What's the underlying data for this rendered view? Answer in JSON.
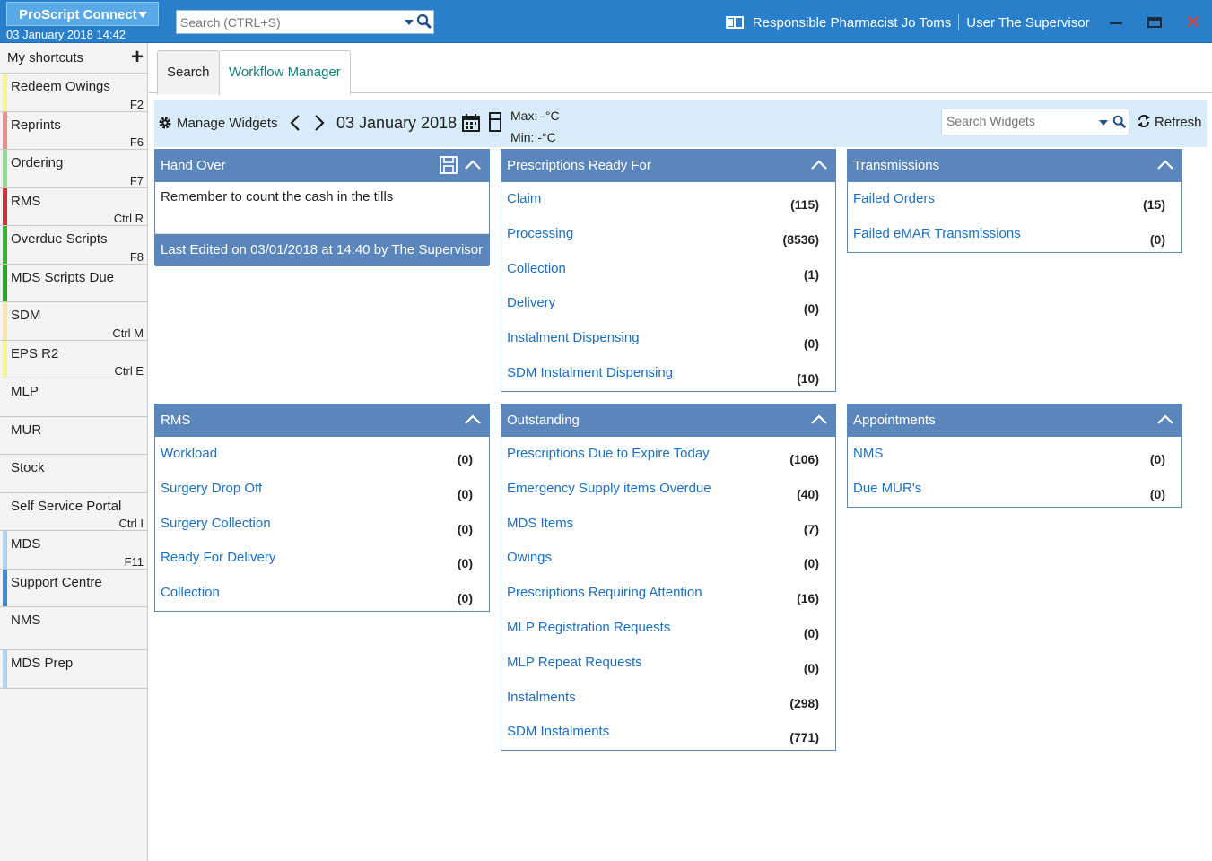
{
  "app": {
    "title": "ProScript Connect",
    "datetime": "03 January 2018 14:42",
    "search_placeholder": "Search (CTRL+S)",
    "pharmacist": "Responsible Pharmacist Jo Toms",
    "user": "User The Supervisor"
  },
  "sidebar": {
    "header": "My shortcuts",
    "items": [
      {
        "label": "Redeem Owings",
        "key": "F2",
        "color": "#f5f58c"
      },
      {
        "label": "Reprints",
        "key": "F6",
        "color": "#f08b8b"
      },
      {
        "label": "Ordering",
        "key": "F7",
        "color": "#8ee08e"
      },
      {
        "label": "RMS",
        "key": "Ctrl R",
        "color": "#e0283c"
      },
      {
        "label": "Overdue Scripts",
        "key": "F8",
        "color": "#2fb52f"
      },
      {
        "label": "MDS Scripts Due",
        "key": "",
        "color": "#1fa81f"
      },
      {
        "label": "SDM",
        "key": "Ctrl M",
        "color": "#f3e6a6"
      },
      {
        "label": "EPS R2",
        "key": "Ctrl E",
        "color": "#f5f58c"
      },
      {
        "label": "MLP",
        "key": "",
        "color": ""
      },
      {
        "label": "MUR",
        "key": "",
        "color": ""
      },
      {
        "label": "Stock",
        "key": "",
        "color": ""
      },
      {
        "label": "Self Service Portal",
        "key": "Ctrl I",
        "color": ""
      },
      {
        "label": "MDS",
        "key": "F11",
        "color": "#a9d3f2"
      },
      {
        "label": "Support Centre",
        "key": "",
        "color": "#3c87d6"
      },
      {
        "label": "NMS",
        "key": "",
        "color": ""
      },
      {
        "label": "MDS Prep",
        "key": "",
        "color": "#a9d3f2"
      }
    ]
  },
  "tabs": [
    {
      "label": "Search"
    },
    {
      "label": "Workflow Manager"
    }
  ],
  "toolbar": {
    "manage": "Manage Widgets",
    "date": "03 January 2018",
    "max": "Max: -°C",
    "min": "Min: -°C",
    "search_placeholder": "Search Widgets",
    "refresh": "Refresh"
  },
  "widgets": {
    "handover": {
      "title": "Hand Over",
      "text": "Remember to count the cash in the tills",
      "footer": "Last Edited on 03/01/2018 at 14:40 by The Supervisor"
    },
    "ready": {
      "title": "Prescriptions Ready For",
      "rows": [
        {
          "label": "Claim",
          "count": "(115)"
        },
        {
          "label": "Processing",
          "count": "(8536)"
        },
        {
          "label": "Collection",
          "count": "(1)"
        },
        {
          "label": "Delivery",
          "count": "(0)"
        },
        {
          "label": "Instalment Dispensing",
          "count": "(0)"
        },
        {
          "label": "SDM Instalment Dispensing",
          "count": "(10)"
        }
      ]
    },
    "transmissions": {
      "title": "Transmissions",
      "rows": [
        {
          "label": "Failed Orders",
          "count": "(15)"
        },
        {
          "label": "Failed eMAR Transmissions",
          "count": "(0)"
        }
      ]
    },
    "rms": {
      "title": "RMS",
      "rows": [
        {
          "label": "Workload",
          "count": "(0)"
        },
        {
          "label": "Surgery Drop Off",
          "count": "(0)"
        },
        {
          "label": "Surgery Collection",
          "count": "(0)"
        },
        {
          "label": "Ready For Delivery",
          "count": "(0)"
        },
        {
          "label": "Collection",
          "count": "(0)"
        }
      ]
    },
    "outstanding": {
      "title": "Outstanding",
      "rows": [
        {
          "label": "Prescriptions Due to Expire Today",
          "count": "(106)"
        },
        {
          "label": "Emergency Supply items Overdue",
          "count": "(40)"
        },
        {
          "label": "MDS Items",
          "count": "(7)"
        },
        {
          "label": "Owings",
          "count": "(0)"
        },
        {
          "label": "Prescriptions Requiring Attention",
          "count": "(16)"
        },
        {
          "label": "MLP Registration Requests",
          "count": "(0)"
        },
        {
          "label": "MLP Repeat Requests",
          "count": "(0)"
        },
        {
          "label": "Instalments",
          "count": "(298)"
        },
        {
          "label": "SDM Instalments",
          "count": "(771)"
        }
      ]
    },
    "appointments": {
      "title": "Appointments",
      "rows": [
        {
          "label": "NMS",
          "count": "(0)"
        },
        {
          "label": "Due MUR's",
          "count": "(0)"
        }
      ]
    }
  }
}
